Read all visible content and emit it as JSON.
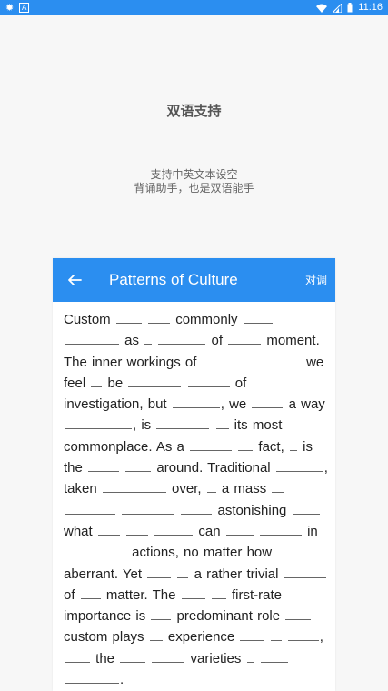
{
  "status_bar": {
    "time": "11:16",
    "left_icon_text": "A"
  },
  "promo": {
    "title": "双语支持",
    "line1": "支持中英文本设空",
    "line2": "背诵助手，也是双语能手"
  },
  "app": {
    "title": "Patterns of Culture",
    "action_label": "对调"
  },
  "passage": [
    {
      "t": "Custom "
    },
    {
      "b": 28
    },
    {
      "t": " "
    },
    {
      "b": 24
    },
    {
      "t": " commonly "
    },
    {
      "b": 32
    },
    {
      "t": " "
    },
    {
      "b": 60
    },
    {
      "t": " as "
    },
    {
      "b": 8
    },
    {
      "t": " "
    },
    {
      "b": 52
    },
    {
      "t": " of "
    },
    {
      "b": 36
    },
    {
      "t": " moment."
    },
    {
      "t": " The inner workings of "
    },
    {
      "b": 24
    },
    {
      "t": " "
    },
    {
      "b": 28
    },
    {
      "t": " "
    },
    {
      "b": 42
    },
    {
      "t": " we"
    },
    {
      "t": " feel "
    },
    {
      "b": 12
    },
    {
      "t": " be "
    },
    {
      "b": 58
    },
    {
      "t": " "
    },
    {
      "b": 46
    },
    {
      "t": " of"
    },
    {
      "t": " investigation, but "
    },
    {
      "b": 52
    },
    {
      "t": ", we "
    },
    {
      "b": 34
    },
    {
      "t": " a"
    },
    {
      "t": " way "
    },
    {
      "b": 74
    },
    {
      "t": ", is "
    },
    {
      "b": 58
    },
    {
      "t": " "
    },
    {
      "b": 14
    },
    {
      "t": " its most"
    },
    {
      "t": " commonplace. As a "
    },
    {
      "b": 46
    },
    {
      "t": " "
    },
    {
      "b": 16
    },
    {
      "t": " fact, "
    },
    {
      "b": 8
    },
    {
      "t": " is"
    },
    {
      "t": " the "
    },
    {
      "b": 34
    },
    {
      "t": " "
    },
    {
      "b": 28
    },
    {
      "t": " around. Traditional"
    },
    {
      "t": " "
    },
    {
      "b": 52
    },
    {
      "t": ", taken "
    },
    {
      "b": 70
    },
    {
      "t": " over, "
    },
    {
      "b": 10
    },
    {
      "t": " a mass"
    },
    {
      "t": " "
    },
    {
      "b": 14
    },
    {
      "t": " "
    },
    {
      "b": 56
    },
    {
      "t": " "
    },
    {
      "b": 58
    },
    {
      "t": " "
    },
    {
      "b": 34
    },
    {
      "t": " astonishing"
    },
    {
      "t": " "
    },
    {
      "b": 30
    },
    {
      "t": " what "
    },
    {
      "b": 24
    },
    {
      "t": " "
    },
    {
      "b": 24
    },
    {
      "t": " "
    },
    {
      "b": 42
    },
    {
      "t": " can "
    },
    {
      "b": 30
    },
    {
      "t": " "
    },
    {
      "b": 46
    },
    {
      "t": " in "
    },
    {
      "b": 68
    },
    {
      "t": " actions, no matter"
    },
    {
      "t": " how aberrant. Yet "
    },
    {
      "b": 26
    },
    {
      "t": " "
    },
    {
      "b": 12
    },
    {
      "t": " a rather trivial"
    },
    {
      "t": " "
    },
    {
      "b": 46
    },
    {
      "t": " of "
    },
    {
      "b": 22
    },
    {
      "t": " matter. The "
    },
    {
      "b": 26
    },
    {
      "t": " "
    },
    {
      "b": 16
    },
    {
      "t": " first-"
    },
    {
      "t": "rate importance is "
    },
    {
      "b": 22
    },
    {
      "t": " predominant role"
    },
    {
      "t": " "
    },
    {
      "b": 28
    },
    {
      "t": " custom plays "
    },
    {
      "b": 14
    },
    {
      "t": " experience "
    },
    {
      "b": 26
    },
    {
      "t": " "
    },
    {
      "b": 12
    },
    {
      "t": " "
    },
    {
      "b": 34
    },
    {
      "t": ", "
    },
    {
      "b": 28
    },
    {
      "t": " the "
    },
    {
      "b": 28
    },
    {
      "t": " "
    },
    {
      "b": 36
    },
    {
      "t": " varieties "
    },
    {
      "b": 8
    },
    {
      "t": " "
    },
    {
      "b": 30
    },
    {
      "t": " "
    },
    {
      "b": 60
    },
    {
      "t": "."
    }
  ],
  "colors": {
    "accent": "#2b8ef0",
    "background": "#f7f7f7"
  }
}
